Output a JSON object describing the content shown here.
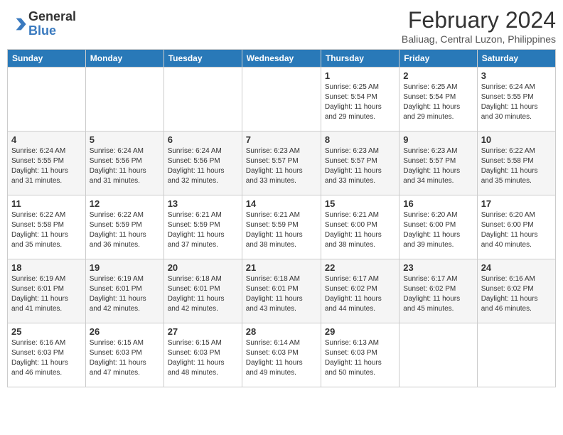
{
  "logo": {
    "general": "General",
    "blue": "Blue"
  },
  "title": {
    "month": "February 2024",
    "location": "Baliuag, Central Luzon, Philippines"
  },
  "headers": [
    "Sunday",
    "Monday",
    "Tuesday",
    "Wednesday",
    "Thursday",
    "Friday",
    "Saturday"
  ],
  "weeks": [
    [
      {
        "day": "",
        "info": ""
      },
      {
        "day": "",
        "info": ""
      },
      {
        "day": "",
        "info": ""
      },
      {
        "day": "",
        "info": ""
      },
      {
        "day": "1",
        "info": "Sunrise: 6:25 AM\nSunset: 5:54 PM\nDaylight: 11 hours\nand 29 minutes."
      },
      {
        "day": "2",
        "info": "Sunrise: 6:25 AM\nSunset: 5:54 PM\nDaylight: 11 hours\nand 29 minutes."
      },
      {
        "day": "3",
        "info": "Sunrise: 6:24 AM\nSunset: 5:55 PM\nDaylight: 11 hours\nand 30 minutes."
      }
    ],
    [
      {
        "day": "4",
        "info": "Sunrise: 6:24 AM\nSunset: 5:55 PM\nDaylight: 11 hours\nand 31 minutes."
      },
      {
        "day": "5",
        "info": "Sunrise: 6:24 AM\nSunset: 5:56 PM\nDaylight: 11 hours\nand 31 minutes."
      },
      {
        "day": "6",
        "info": "Sunrise: 6:24 AM\nSunset: 5:56 PM\nDaylight: 11 hours\nand 32 minutes."
      },
      {
        "day": "7",
        "info": "Sunrise: 6:23 AM\nSunset: 5:57 PM\nDaylight: 11 hours\nand 33 minutes."
      },
      {
        "day": "8",
        "info": "Sunrise: 6:23 AM\nSunset: 5:57 PM\nDaylight: 11 hours\nand 33 minutes."
      },
      {
        "day": "9",
        "info": "Sunrise: 6:23 AM\nSunset: 5:57 PM\nDaylight: 11 hours\nand 34 minutes."
      },
      {
        "day": "10",
        "info": "Sunrise: 6:22 AM\nSunset: 5:58 PM\nDaylight: 11 hours\nand 35 minutes."
      }
    ],
    [
      {
        "day": "11",
        "info": "Sunrise: 6:22 AM\nSunset: 5:58 PM\nDaylight: 11 hours\nand 35 minutes."
      },
      {
        "day": "12",
        "info": "Sunrise: 6:22 AM\nSunset: 5:59 PM\nDaylight: 11 hours\nand 36 minutes."
      },
      {
        "day": "13",
        "info": "Sunrise: 6:21 AM\nSunset: 5:59 PM\nDaylight: 11 hours\nand 37 minutes."
      },
      {
        "day": "14",
        "info": "Sunrise: 6:21 AM\nSunset: 5:59 PM\nDaylight: 11 hours\nand 38 minutes."
      },
      {
        "day": "15",
        "info": "Sunrise: 6:21 AM\nSunset: 6:00 PM\nDaylight: 11 hours\nand 38 minutes."
      },
      {
        "day": "16",
        "info": "Sunrise: 6:20 AM\nSunset: 6:00 PM\nDaylight: 11 hours\nand 39 minutes."
      },
      {
        "day": "17",
        "info": "Sunrise: 6:20 AM\nSunset: 6:00 PM\nDaylight: 11 hours\nand 40 minutes."
      }
    ],
    [
      {
        "day": "18",
        "info": "Sunrise: 6:19 AM\nSunset: 6:01 PM\nDaylight: 11 hours\nand 41 minutes."
      },
      {
        "day": "19",
        "info": "Sunrise: 6:19 AM\nSunset: 6:01 PM\nDaylight: 11 hours\nand 42 minutes."
      },
      {
        "day": "20",
        "info": "Sunrise: 6:18 AM\nSunset: 6:01 PM\nDaylight: 11 hours\nand 42 minutes."
      },
      {
        "day": "21",
        "info": "Sunrise: 6:18 AM\nSunset: 6:01 PM\nDaylight: 11 hours\nand 43 minutes."
      },
      {
        "day": "22",
        "info": "Sunrise: 6:17 AM\nSunset: 6:02 PM\nDaylight: 11 hours\nand 44 minutes."
      },
      {
        "day": "23",
        "info": "Sunrise: 6:17 AM\nSunset: 6:02 PM\nDaylight: 11 hours\nand 45 minutes."
      },
      {
        "day": "24",
        "info": "Sunrise: 6:16 AM\nSunset: 6:02 PM\nDaylight: 11 hours\nand 46 minutes."
      }
    ],
    [
      {
        "day": "25",
        "info": "Sunrise: 6:16 AM\nSunset: 6:03 PM\nDaylight: 11 hours\nand 46 minutes."
      },
      {
        "day": "26",
        "info": "Sunrise: 6:15 AM\nSunset: 6:03 PM\nDaylight: 11 hours\nand 47 minutes."
      },
      {
        "day": "27",
        "info": "Sunrise: 6:15 AM\nSunset: 6:03 PM\nDaylight: 11 hours\nand 48 minutes."
      },
      {
        "day": "28",
        "info": "Sunrise: 6:14 AM\nSunset: 6:03 PM\nDaylight: 11 hours\nand 49 minutes."
      },
      {
        "day": "29",
        "info": "Sunrise: 6:13 AM\nSunset: 6:03 PM\nDaylight: 11 hours\nand 50 minutes."
      },
      {
        "day": "",
        "info": ""
      },
      {
        "day": "",
        "info": ""
      }
    ]
  ]
}
